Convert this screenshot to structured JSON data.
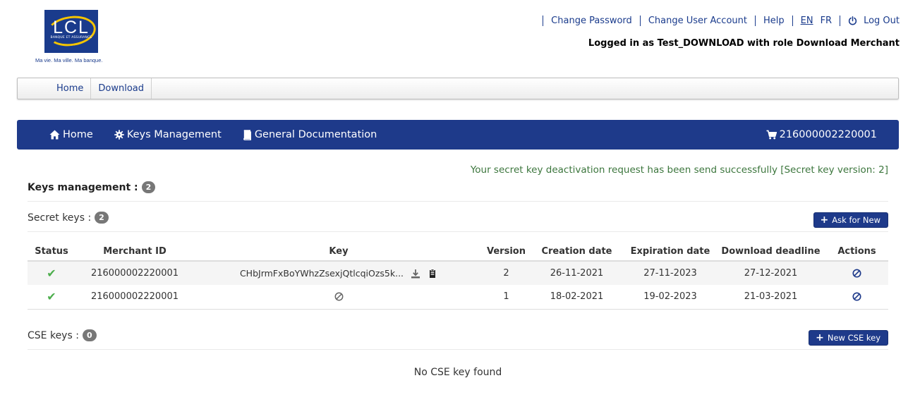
{
  "logo": {
    "letters": "LCL",
    "sub": "BANQUE ET ASSURANCE",
    "tagline": "Ma vie. Ma ville. Ma banque."
  },
  "top_links": {
    "change_password": "Change Password",
    "change_user_account": "Change User Account",
    "help": "Help",
    "lang_en": "EN",
    "lang_fr": "FR",
    "logout": "Log Out"
  },
  "logged_in": "Logged in as Test_DOWNLOAD with role Download Merchant",
  "breadcrumb": {
    "home": "Home",
    "download": "Download"
  },
  "nav": {
    "home": "Home",
    "keys": "Keys Management",
    "docs": "General Documentation",
    "merchant": "216000002220001"
  },
  "alert": "Your secret key deactivation request has been send successfully [Secret key version: 2]",
  "keys_section": {
    "title": "Keys management :",
    "count": "2"
  },
  "secret_keys": {
    "title": "Secret keys :",
    "count": "2",
    "button": "Ask for New",
    "columns": [
      "Status",
      "Merchant ID",
      "Key",
      "Version",
      "Creation date",
      "Expiration date",
      "Download deadline",
      "Actions"
    ],
    "rows": [
      {
        "merchant_id": "216000002220001",
        "key": "CHbJrmFxBoYWhzZsexjQtlcqiOzs5k...",
        "version": "2",
        "creation": "26-11-2021",
        "expiration": "27-11-2023",
        "deadline": "27-12-2021"
      },
      {
        "merchant_id": "216000002220001",
        "key": "",
        "version": "1",
        "creation": "18-02-2021",
        "expiration": "19-02-2023",
        "deadline": "21-03-2021"
      }
    ]
  },
  "cse_keys": {
    "title": "CSE keys :",
    "count": "0",
    "button": "New CSE key",
    "empty": "No CSE key found"
  },
  "colors": {
    "brand_blue": "#1e3a8a",
    "success_green": "#3c763d",
    "check_green": "#4cae4c",
    "badge_grey": "#777777"
  },
  "icons": {
    "status_ok": "check-icon",
    "download": "download-icon",
    "copy": "clipboard-icon",
    "deactivate": "ban-icon",
    "home": "home-icon",
    "keys": "gear-icon",
    "docs": "book-icon",
    "cart": "cart-icon",
    "logout": "power-icon",
    "add": "plus-icon"
  }
}
